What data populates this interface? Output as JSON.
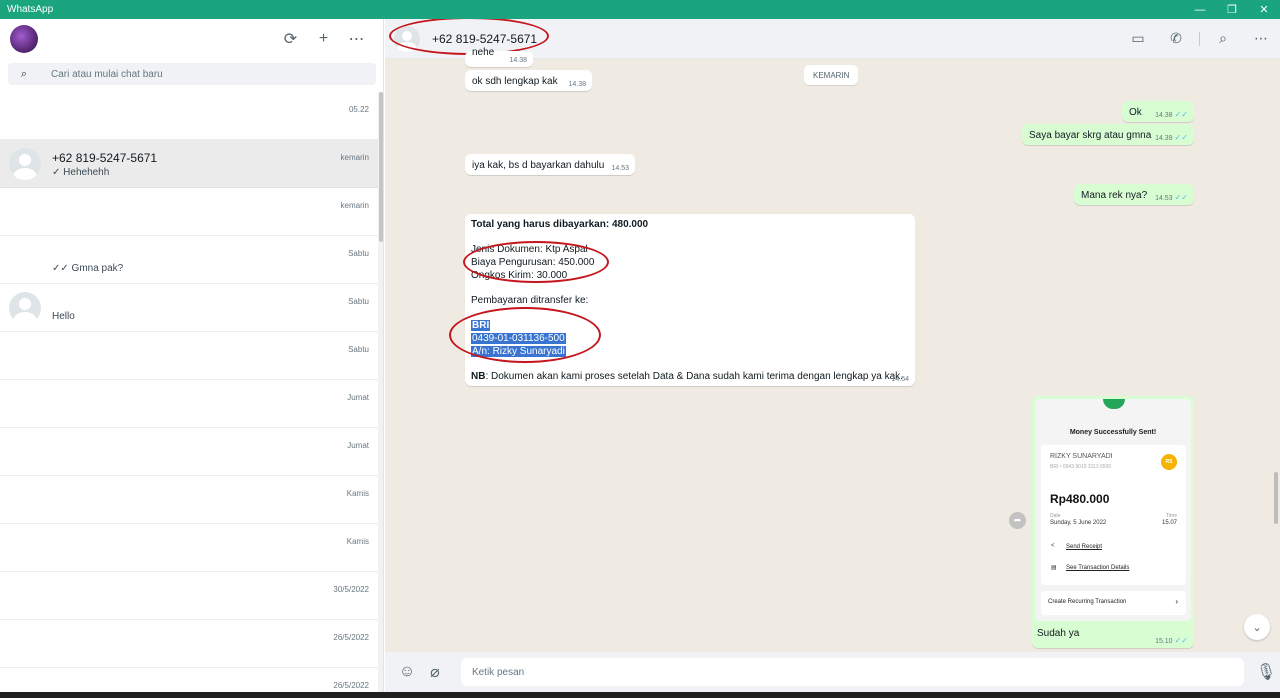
{
  "window": {
    "title": "WhatsApp",
    "minimize": "—",
    "restore": "❐",
    "close": "✕"
  },
  "sidebar": {
    "icons": {
      "refresh": "⟳",
      "new_chat": "+",
      "menu": "⋯"
    },
    "search": {
      "placeholder": "Cari atau mulai chat baru",
      "icon": "⌕"
    },
    "chats": [
      {
        "name": "",
        "message": "",
        "time": "05.22",
        "active": false
      },
      {
        "name": "+62 819-5247-5671",
        "message": "✓ Hehehehh",
        "time": "kemarin",
        "active": true
      },
      {
        "name": "",
        "message": "",
        "time": "kemarin",
        "active": false
      },
      {
        "name": "",
        "message": "✓✓ Gmna pak?",
        "time": "Sabtu",
        "active": false
      },
      {
        "name": "",
        "message": "Hello",
        "time": "Sabtu",
        "active": false
      },
      {
        "name": "",
        "message": "",
        "time": "Sabtu",
        "active": false
      },
      {
        "name": "",
        "message": "",
        "time": "Jumat",
        "active": false
      },
      {
        "name": "",
        "message": "",
        "time": "Jumat",
        "active": false
      },
      {
        "name": "",
        "message": "",
        "time": "Kamis",
        "active": false
      },
      {
        "name": "",
        "message": "",
        "time": "Kamis",
        "active": false
      },
      {
        "name": "",
        "message": "",
        "time": "30/5/2022",
        "active": false
      },
      {
        "name": "",
        "message": "",
        "time": "26/5/2022",
        "active": false
      },
      {
        "name": "",
        "message": "",
        "time": "26/5/2022",
        "active": false
      }
    ]
  },
  "conversation": {
    "contact_name": "+62 819-5247-5671",
    "header_icons": {
      "video": "▭",
      "call": "✆",
      "search": "⌕",
      "menu": "⋯"
    },
    "date_chip": "KEMARIN",
    "messages": [
      {
        "text": "nehe",
        "time": "14.38"
      },
      {
        "text": "ok sdh lengkap kak",
        "time": "14.38"
      },
      {
        "text": "Ok",
        "time": "14.38"
      },
      {
        "text": "Saya bayar skrg atau gmna",
        "time": "14.39"
      },
      {
        "text": "iya kak, bs d bayarkan dahulu",
        "time": "14.53"
      },
      {
        "text": "Mana rek nya?",
        "time": "14.53"
      }
    ],
    "invoice": {
      "total_line": "Total yang harus dibayarkan: 480.000",
      "doc_line": "Jenis Dokumen: Ktp Aspal",
      "fee_line": "Biaya Pengurusan: 450.000",
      "ship_line": "Ongkos Kirim: 30.000",
      "transfer_line": "Pembayaran ditransfer ke:",
      "bank": "BRI",
      "account": "0439-01-031136-500",
      "holder": "A/n: Rizky Sunaryadi",
      "nb_label": "NB",
      "nb_text": ": Dokumen akan kami proses setelah Data & Dana sudah kami terima dengan lengkap ya kak.",
      "time": "14.54"
    },
    "receipt": {
      "title": "Money Successfully Sent!",
      "recipient": "RIZKY SUNARYADI",
      "account": "BRI • 0043 9010 3113 6500",
      "badge": "RS",
      "amount": "Rp480.000",
      "date_label": "Date",
      "date_value": "Sunday, 5 June 2022",
      "time_label": "Time",
      "time_value": "15.07",
      "send_receipt": "Send Receipt",
      "see_details": "See Transaction Details",
      "recurring": "Create Recurring Transaction",
      "caption": "Sudah ya",
      "msg_time": "15.10"
    },
    "composer": {
      "placeholder": "Ketik pesan",
      "emoji_icon": "☺",
      "attach_icon": "⌀",
      "mic_icon": "🎙"
    }
  },
  "colors": {
    "accent": "#1aa57f",
    "outgoing": "#d9fdd3",
    "annotation_red": "#c4161c",
    "highlight": "#3874d0"
  }
}
